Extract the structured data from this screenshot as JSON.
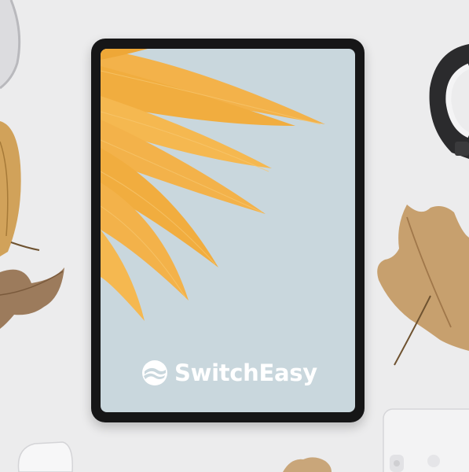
{
  "tablet": {
    "brand_name": "SwitchEasy",
    "logo_icon": "switcheasy-swirl-icon"
  },
  "colors": {
    "background": "#ececed",
    "screen": "#c9d7dd",
    "petal": "#f3b24a",
    "bezel": "#161617",
    "leaf": "#c7a06e"
  }
}
